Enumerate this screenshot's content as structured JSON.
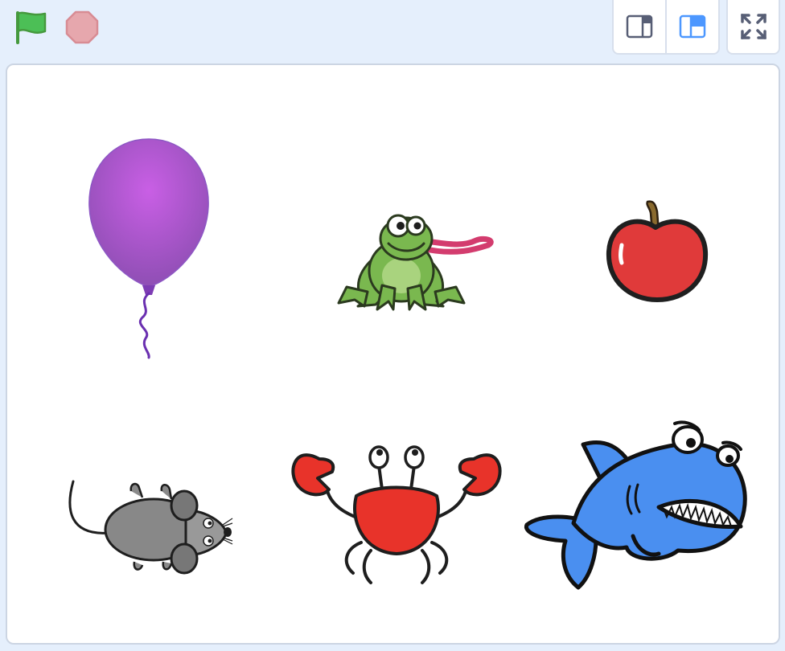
{
  "toolbar": {
    "green_flag_icon": "green-flag-icon",
    "stop_icon": "stop-sign-icon",
    "small_stage_icon": "small-stage-mode-icon",
    "normal_stage_icon": "normal-stage-mode-icon",
    "fullscreen_icon": "fullscreen-icon"
  },
  "colors": {
    "background": "#e5effc",
    "flag_green": "#4cbf56",
    "stop_red": "#e6a7ad",
    "mode_active_blue": "#4c97ff",
    "mode_inactive_gray": "#575e75"
  },
  "stage": {
    "sprites": [
      "balloon",
      "frog",
      "apple",
      "mouse",
      "crab",
      "shark"
    ]
  }
}
